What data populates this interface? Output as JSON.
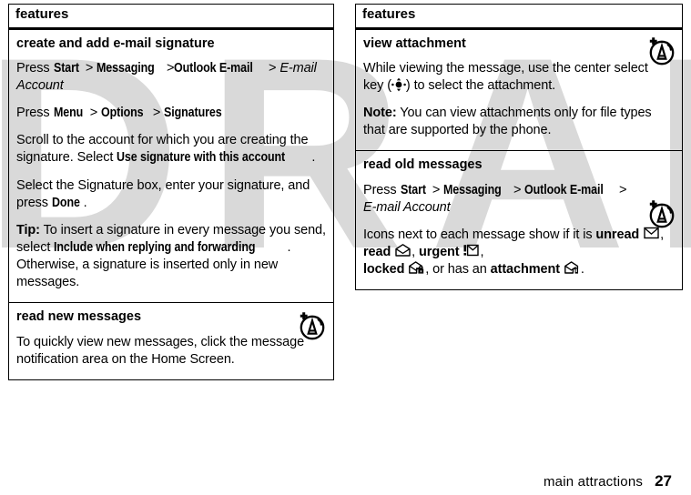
{
  "document": {
    "watermark": "DRAFT",
    "footer": {
      "chapter": "main attractions",
      "page_number": "27"
    }
  },
  "left_column": {
    "header": "features",
    "rows": [
      {
        "title": "create and add e-mail signature",
        "paragraphs": [
          {
            "id": "p1",
            "segments": [
              {
                "t": "Press ",
                "style": "plain"
              },
              {
                "t": "Start",
                "style": "ui"
              },
              {
                "t": " > ",
                "style": "plain"
              },
              {
                "t": "Messaging",
                "style": "ui"
              },
              {
                "t": " >",
                "style": "plain"
              },
              {
                "t": "Outlook E-mail",
                "style": "ui"
              },
              {
                "t": " > ",
                "style": "plain"
              },
              {
                "t": "E-mail Account",
                "style": "italic"
              }
            ]
          },
          {
            "id": "p2",
            "segments": [
              {
                "t": "Press ",
                "style": "plain"
              },
              {
                "t": "Menu",
                "style": "ui"
              },
              {
                "t": " > ",
                "style": "plain"
              },
              {
                "t": "Options",
                "style": "ui"
              },
              {
                "t": " > ",
                "style": "plain"
              },
              {
                "t": "Signatures",
                "style": "ui"
              }
            ]
          },
          {
            "id": "p3",
            "segments": [
              {
                "t": "Scroll to the account for which you are creating the signature. Select ",
                "style": "plain"
              },
              {
                "t": "Use signature with this account",
                "style": "ui"
              },
              {
                "t": ".",
                "style": "plain"
              }
            ]
          },
          {
            "id": "p4",
            "segments": [
              {
                "t": "Select the Signature box, enter your signature, and press ",
                "style": "plain"
              },
              {
                "t": "Done",
                "style": "ui"
              },
              {
                "t": ".",
                "style": "plain"
              }
            ]
          },
          {
            "id": "p5",
            "segments": [
              {
                "t": "Tip:",
                "style": "bold"
              },
              {
                "t": " To insert a signature in every message you send, select ",
                "style": "plain"
              },
              {
                "t": "Include when replying and forwarding",
                "style": "ui"
              },
              {
                "t": ". Otherwise, a signature is inserted only in new messages.",
                "style": "plain"
              }
            ]
          }
        ]
      },
      {
        "title": "read new messages",
        "icon": "motorola-tip-badge-icon",
        "paragraphs": [
          {
            "id": "p6",
            "segments": [
              {
                "t": "To quickly view new messages, click the message notification area on the Home Screen.",
                "style": "plain"
              }
            ]
          }
        ]
      }
    ]
  },
  "right_column": {
    "header": "features",
    "rows": [
      {
        "title": "view attachment",
        "icon": "motorola-tip-badge-icon",
        "paragraphs": [
          {
            "id": "p7",
            "segments": [
              {
                "t": "While viewing the message, use the center select key (",
                "style": "plain"
              },
              {
                "t": "center-select-key-icon",
                "style": "navkey"
              },
              {
                "t": ") to select the attachment.",
                "style": "plain"
              }
            ]
          },
          {
            "id": "p8",
            "segments": [
              {
                "t": "Note:",
                "style": "bold"
              },
              {
                "t": " You can view attachments only for file types that are supported by the phone.",
                "style": "plain"
              }
            ]
          }
        ]
      },
      {
        "title": "read old messages",
        "icon": "motorola-tip-badge-icon",
        "paragraphs": [
          {
            "id": "p9",
            "segments": [
              {
                "t": "Press ",
                "style": "plain"
              },
              {
                "t": "Start",
                "style": "ui"
              },
              {
                "t": " > ",
                "style": "plain"
              },
              {
                "t": "Messaging",
                "style": "ui"
              },
              {
                "t": " > ",
                "style": "plain"
              },
              {
                "t": "Outlook E-mail",
                "style": "ui"
              },
              {
                "t": " > ",
                "style": "plain"
              },
              {
                "t": "E-mail Account",
                "style": "italic"
              }
            ]
          },
          {
            "id": "p10",
            "segments": [
              {
                "t": "Icons next to each message show if it is ",
                "style": "plain"
              },
              {
                "t": "unread",
                "style": "bold"
              },
              {
                "t": " ",
                "style": "plain"
              },
              {
                "t": "envelope-closed-icon",
                "style": "env"
              },
              {
                "t": ", ",
                "style": "plain"
              },
              {
                "t": "read",
                "style": "bold"
              },
              {
                "t": " ",
                "style": "plain"
              },
              {
                "t": "envelope-open-icon",
                "style": "env"
              },
              {
                "t": ", ",
                "style": "plain"
              },
              {
                "t": "urgent",
                "style": "bold"
              },
              {
                "t": " ",
                "style": "plain"
              },
              {
                "t": "envelope-urgent-icon",
                "style": "env"
              },
              {
                "t": ", ",
                "style": "plain"
              },
              {
                "t": "locked",
                "style": "bold"
              },
              {
                "t": " ",
                "style": "plain"
              },
              {
                "t": "envelope-locked-icon",
                "style": "env"
              },
              {
                "t": ", or has an ",
                "style": "plain"
              },
              {
                "t": "attachment",
                "style": "bold"
              },
              {
                "t": " ",
                "style": "plain"
              },
              {
                "t": "envelope-attachment-icon",
                "style": "env"
              },
              {
                "t": ".",
                "style": "plain"
              }
            ]
          }
        ]
      }
    ]
  },
  "colors": {
    "ink": "#000000",
    "paper": "#ffffff",
    "watermark": "#d9d9d9"
  }
}
